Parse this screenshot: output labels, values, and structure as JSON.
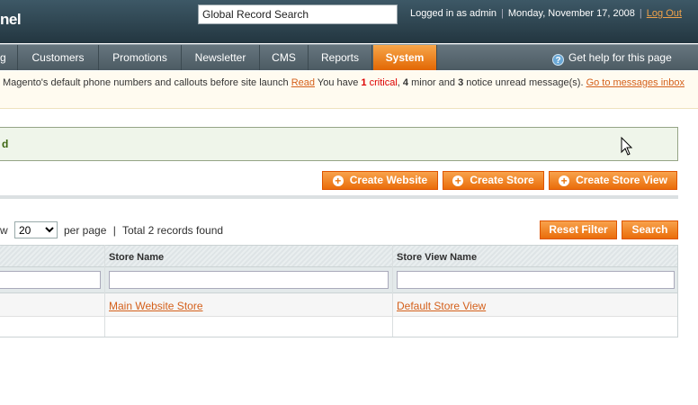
{
  "header": {
    "logo_fragment": "nel",
    "search_value": "Global Record Search",
    "logged_in": "Logged in as admin",
    "date": "Monday, November 17, 2008",
    "logout": "Log Out"
  },
  "nav": {
    "items": [
      {
        "label": "g"
      },
      {
        "label": "Customers"
      },
      {
        "label": "Promotions"
      },
      {
        "label": "Newsletter"
      },
      {
        "label": "CMS"
      },
      {
        "label": "Reports"
      },
      {
        "label": "System"
      }
    ],
    "active": "System",
    "help": "Get help for this page"
  },
  "notice": {
    "text_start": "Magento's default phone numbers and callouts before site launch",
    "read": "Read",
    "you_have": "You have",
    "critical_count": "1",
    "critical_label": "critical",
    "minor_count": "4",
    "minor_label": "minor and",
    "notice_count": "3",
    "notice_label": "notice unread message(s).",
    "link": "Go to messages inbox"
  },
  "success": {
    "message_fragment": "d"
  },
  "buttons": {
    "create_website": "Create Website",
    "create_store": "Create Store",
    "create_store_view": "Create Store View",
    "reset_filter": "Reset Filter",
    "search": "Search"
  },
  "pager": {
    "view_fragment": "w",
    "per_page_value": "20",
    "per_page_label": "per page",
    "sep": "|",
    "total": "Total 2 records found"
  },
  "grid": {
    "columns": [
      "Store Name",
      "Store View Name"
    ],
    "rows": [
      {
        "store_name": "Main Website Store",
        "store_view_name": "Default Store View"
      }
    ]
  },
  "colors": {
    "accent": "#f18200",
    "header": "#2d444f",
    "link": "#d4601b"
  }
}
